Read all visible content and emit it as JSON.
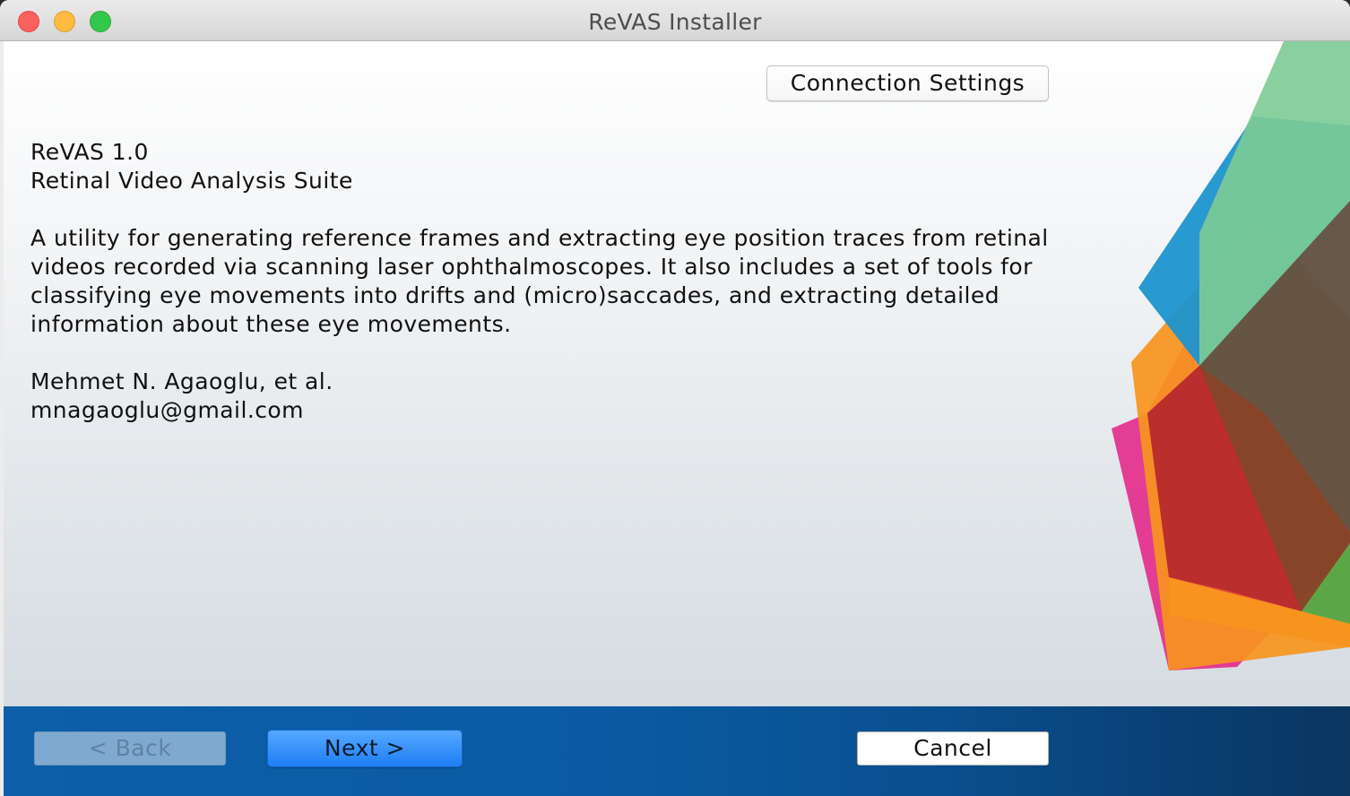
{
  "window": {
    "title": "ReVAS Installer"
  },
  "header": {
    "connection_settings_label": "Connection Settings"
  },
  "info": {
    "product_name": "ReVAS 1.0",
    "product_full_name": "Retinal Video Analysis Suite",
    "description_lines": [
      "A utility for generating reference frames and extracting eye position traces from retinal",
      "videos recorded via scanning laser ophthalmoscopes. It also includes a set of tools for",
      "classifying eye movements into drifts and (micro)saccades, and extracting detailed",
      "information about these eye movements."
    ],
    "author": "Mehmet N. Agaoglu, et al.",
    "email": "mnagaoglu@gmail.com"
  },
  "footer": {
    "back_label": "< Back",
    "next_label": "Next >",
    "cancel_label": "Cancel"
  },
  "colors": {
    "footer_blue": "#0a5ba3",
    "next_button": "#1f7ef5",
    "back_button_disabled": "#7fa9cf"
  }
}
